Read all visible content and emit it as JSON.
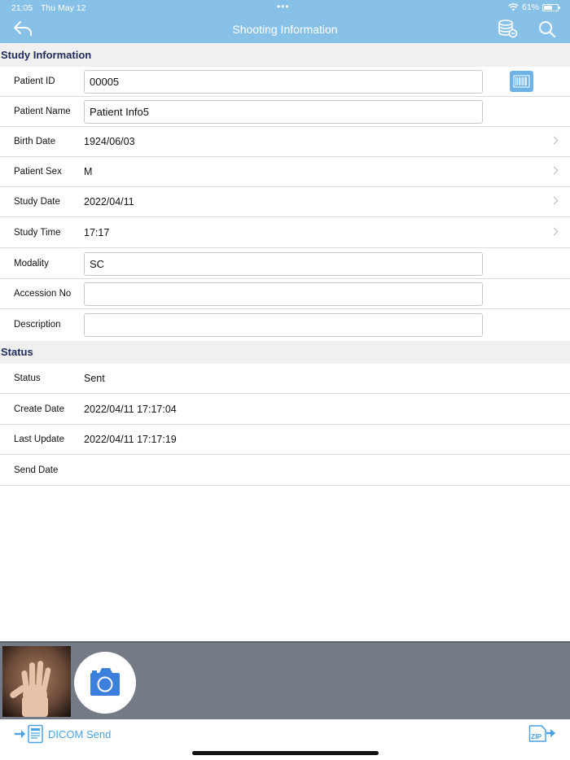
{
  "status_bar": {
    "time": "21:05",
    "date": "Thu May 12",
    "dots": "•••",
    "battery": "61%"
  },
  "nav": {
    "title": "Shooting Information"
  },
  "study_section": {
    "title": "Study Information",
    "patient_id": {
      "label": "Patient ID",
      "value": "00005"
    },
    "patient_name": {
      "label": "Patient Name",
      "value": "Patient Info5"
    },
    "birth_date": {
      "label": "Birth Date",
      "value": "1924/06/03"
    },
    "patient_sex": {
      "label": "Patient Sex",
      "value": "M"
    },
    "study_date": {
      "label": "Study Date",
      "value": "2022/04/11"
    },
    "study_time": {
      "label": "Study Time",
      "value": "17:17"
    },
    "modality": {
      "label": "Modality",
      "value": "SC"
    },
    "accession_no": {
      "label": "Accession No",
      "value": ""
    },
    "description": {
      "label": "Description",
      "value": ""
    }
  },
  "status_section": {
    "title": "Status",
    "status": {
      "label": "Status",
      "value": "Sent"
    },
    "create_date": {
      "label": "Create Date",
      "value": "2022/04/11 17:17:04"
    },
    "last_update": {
      "label": "Last Update",
      "value": "2022/04/11 17:17:19"
    },
    "send_date": {
      "label": "Send Date",
      "value": ""
    }
  },
  "toolbar": {
    "dicom_send_label": "DICOM Send",
    "zip_label": "ZIP"
  },
  "colors": {
    "nav_bar": "#87c1e8",
    "accent": "#4aa3e4",
    "section_title": "#1f2a5c",
    "camera_icon": "#3c7fdc",
    "strip_bg": "#747a86"
  }
}
